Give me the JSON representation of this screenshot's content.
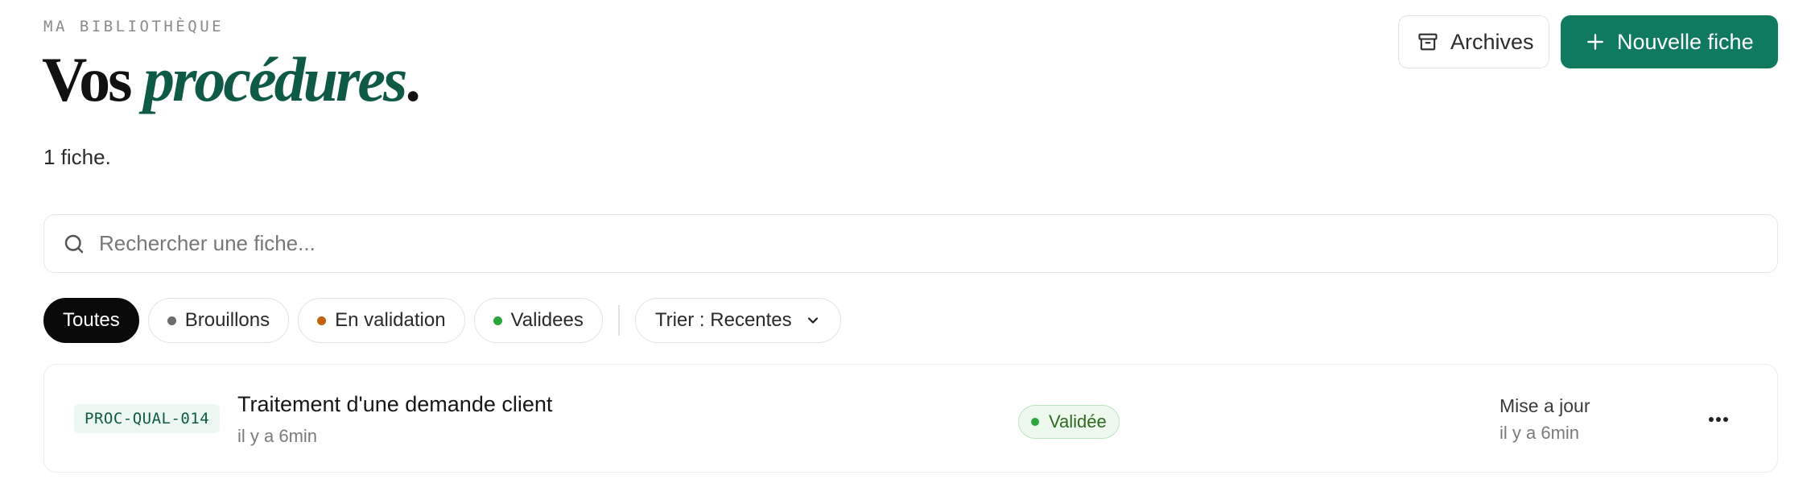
{
  "header": {
    "eyebrow": "MA BIBLIOTHÈQUE",
    "title_part1": "Vos ",
    "title_accent": "procédures",
    "title_end": ".",
    "count": "1 fiche."
  },
  "actions": {
    "archives_label": "Archives",
    "new_label": "Nouvelle fiche"
  },
  "search": {
    "placeholder": "Rechercher une fiche...",
    "value": ""
  },
  "filters": {
    "chips": [
      {
        "label": "Toutes",
        "active": true
      },
      {
        "label": "Brouillons",
        "dot_color": "#6b6b6b"
      },
      {
        "label": "En validation",
        "dot_color": "#c2620a"
      },
      {
        "label": "Validees",
        "dot_color": "#2aa63a"
      }
    ],
    "sort_label": "Trier : Recentes"
  },
  "items": [
    {
      "code": "PROC-QUAL-014",
      "title": "Traitement d'une demande client",
      "subtitle": "il y a 6min",
      "status": "Validée",
      "updated_label": "Mise a jour",
      "updated_value": "il y a 6min"
    }
  ],
  "colors": {
    "brand": "#0f7a5e",
    "accent_text": "#0f5a46",
    "status_green": "#2aa63a"
  },
  "icons": [
    "archive-icon",
    "plus-icon",
    "search-icon",
    "chevron-down-icon",
    "more-horizontal-icon"
  ]
}
